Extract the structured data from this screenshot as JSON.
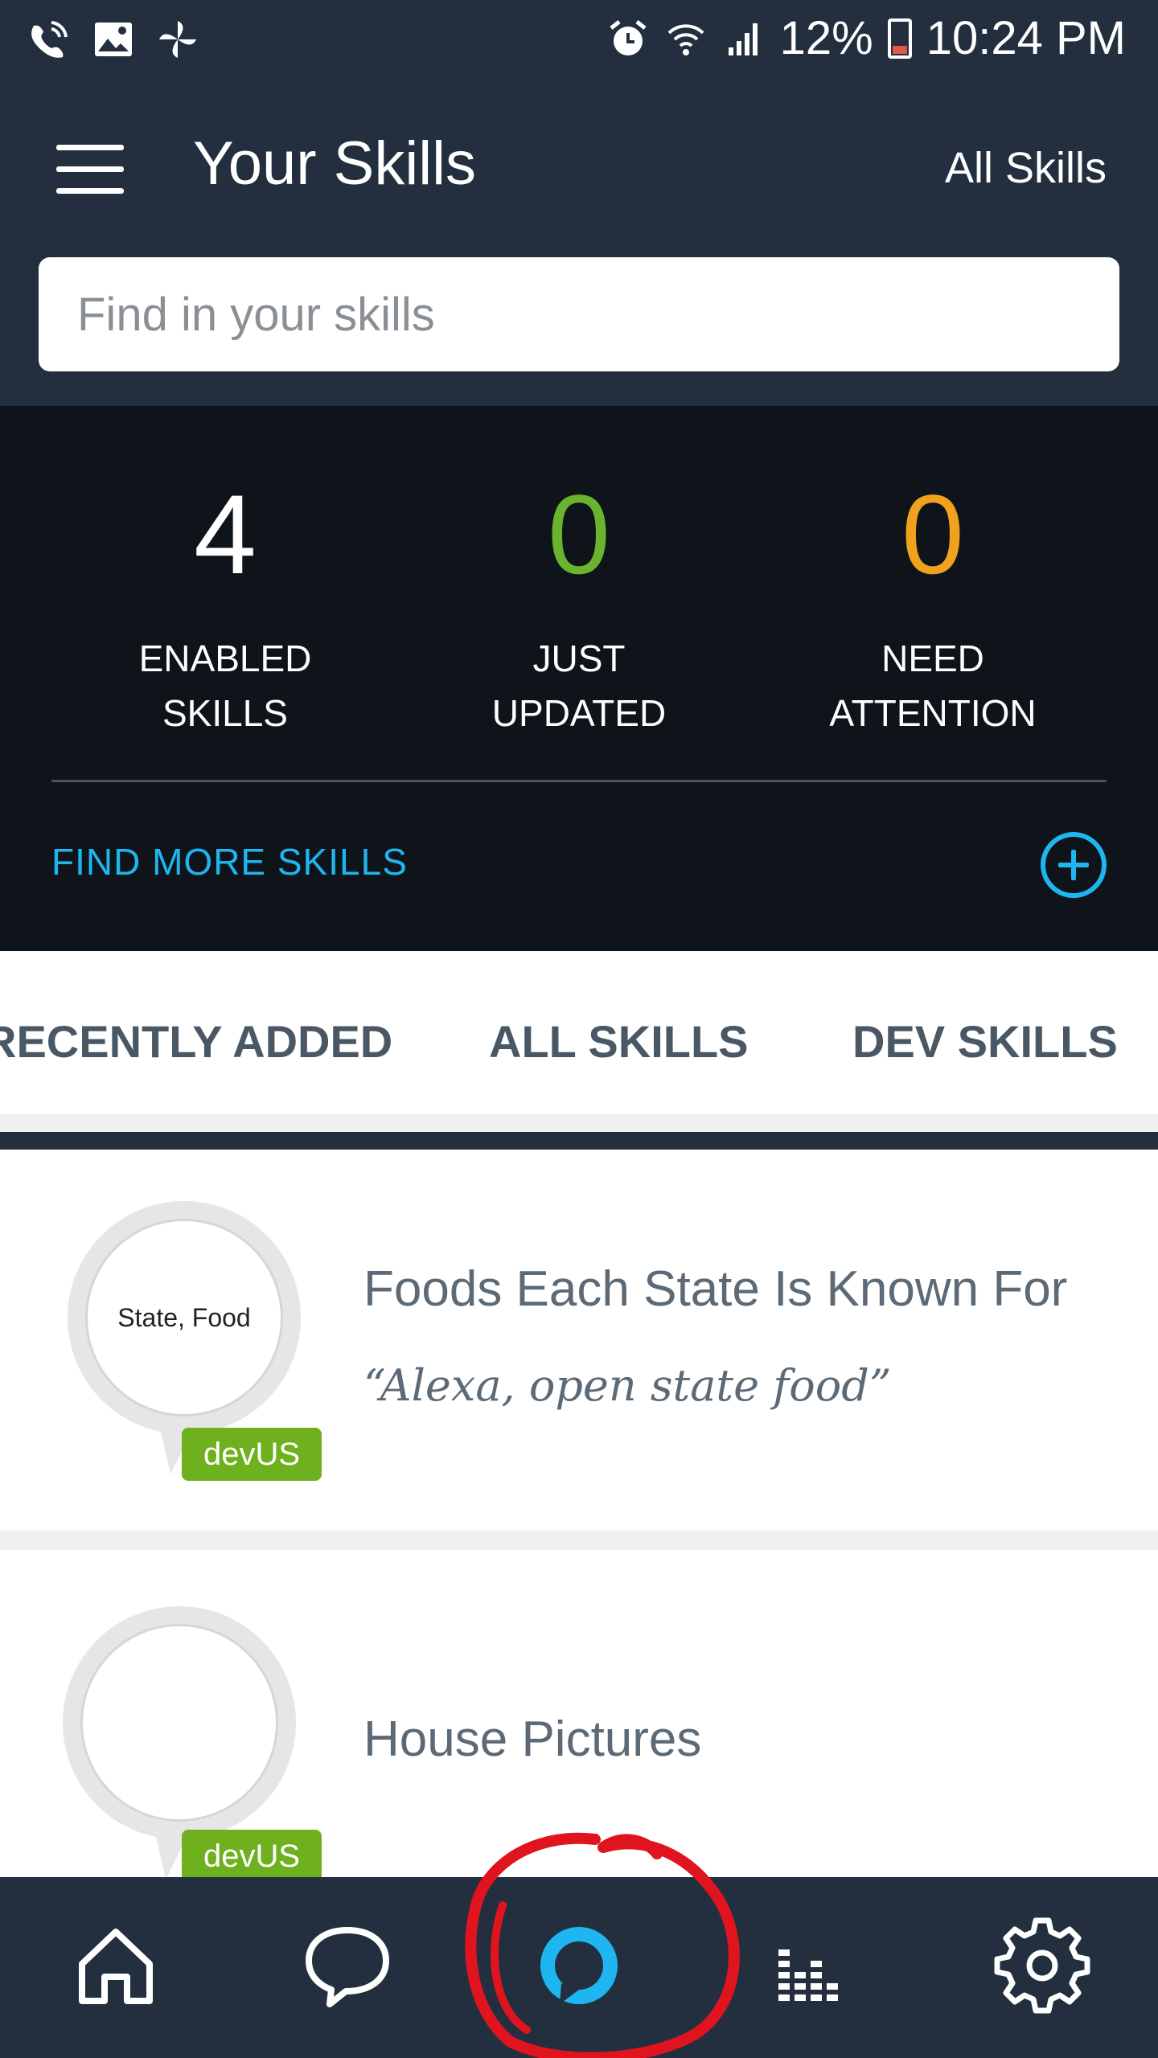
{
  "status_bar": {
    "battery": "12%",
    "time": "10:24 PM"
  },
  "header": {
    "title": "Your Skills",
    "all_skills_link": "All Skills",
    "search_placeholder": "Find in your skills"
  },
  "stats": [
    {
      "value": "4",
      "label": "ENABLED\nSKILLS",
      "color": "#ffffff"
    },
    {
      "value": "0",
      "label": "JUST\nUPDATED",
      "color": "#6ab42d"
    },
    {
      "value": "0",
      "label": "NEED\nATTENTION",
      "color": "#f0a21e"
    }
  ],
  "find_more": "FIND MORE SKILLS",
  "tabs": [
    {
      "label": "RECENTLY ADDED"
    },
    {
      "label": "ALL SKILLS"
    },
    {
      "label": "DEV SKILLS",
      "selected": true
    }
  ],
  "skills": [
    {
      "icon_text": "State, Food",
      "badge": "devUS",
      "name": "Foods Each State Is Known For",
      "phrase": "“Alexa, open state food”"
    },
    {
      "icon_text": "",
      "badge": "devUS",
      "name": "House Pictures",
      "phrase": ""
    }
  ],
  "bottom_nav": [
    "home-icon",
    "chat-icon",
    "alexa-icon",
    "play-queue-icon",
    "settings-icon"
  ],
  "colors": {
    "accent": "#1eb6f0",
    "header_bg": "#232f3e",
    "stats_bg": "#0f141a",
    "badge": "#6fb01e",
    "annotation": "#e0141e"
  }
}
